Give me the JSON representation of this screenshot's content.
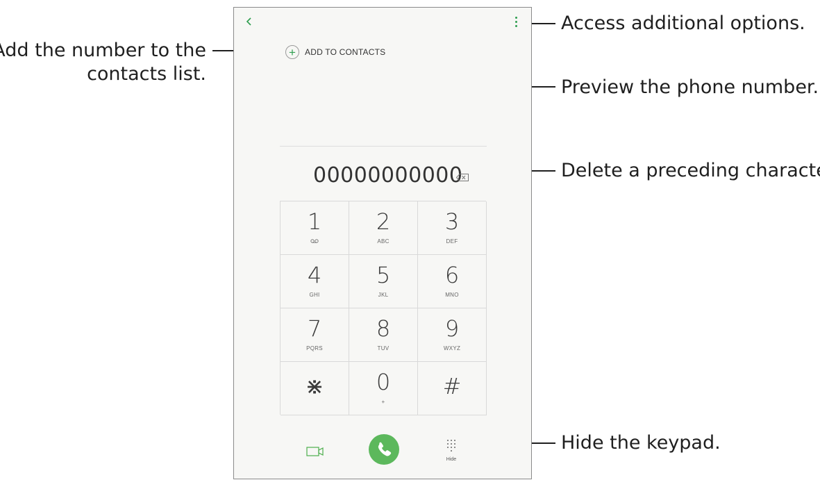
{
  "callouts": {
    "add_contacts_line1": "Add the number to the",
    "add_contacts_line2": "contacts list.",
    "options": "Access additional options.",
    "preview": "Preview the phone number.",
    "delete": "Delete a preceding character.",
    "hide": "Hide the keypad."
  },
  "dialer": {
    "add_to_contacts_label": "ADD TO CONTACTS",
    "number": "00000000000",
    "hide_label": "Hide",
    "keys": [
      {
        "digit": "1",
        "letters": "ᴑᴑ"
      },
      {
        "digit": "2",
        "letters": "ABC"
      },
      {
        "digit": "3",
        "letters": "DEF"
      },
      {
        "digit": "4",
        "letters": "GHI"
      },
      {
        "digit": "5",
        "letters": "JKL"
      },
      {
        "digit": "6",
        "letters": "MNO"
      },
      {
        "digit": "7",
        "letters": "PQRS"
      },
      {
        "digit": "8",
        "letters": "TUV"
      },
      {
        "digit": "9",
        "letters": "WXYZ"
      },
      {
        "digit": "⋇",
        "letters": ""
      },
      {
        "digit": "0",
        "letters": "+"
      },
      {
        "digit": "#",
        "letters": ""
      }
    ]
  },
  "colors": {
    "accent_green": "#2e9e4f",
    "call_button": "#5cb85c"
  },
  "icons": {
    "back": "chevron-left-icon",
    "more": "more-vertical-icon",
    "add": "plus-circle-icon",
    "backspace": "backspace-icon",
    "video": "video-call-icon",
    "call": "phone-icon",
    "hide": "keypad-icon"
  }
}
